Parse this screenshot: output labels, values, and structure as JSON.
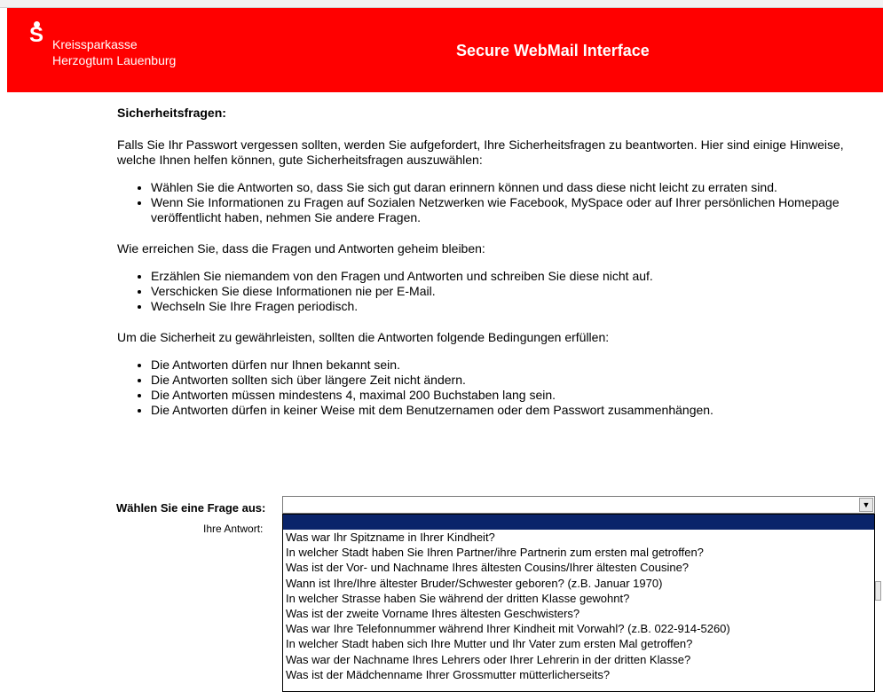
{
  "header": {
    "bank_name_line1": "Kreissparkasse",
    "bank_name_line2": "Herzogtum Lauenburg",
    "title": "Secure WebMail Interface",
    "brand_color": "#ff0000"
  },
  "content": {
    "heading": "Sicherheitsfragen:",
    "intro": "Falls Sie Ihr Passwort vergessen sollten, werden Sie aufgefordert, Ihre Sicherheitsfragen zu beantworten. Hier sind einige Hinweise, welche Ihnen helfen können, gute Sicherheitsfragen auszuwählen:",
    "tips": [
      "Wählen Sie die Antworten so, dass Sie sich gut daran erinnern können und dass diese nicht leicht zu erraten sind.",
      "Wenn Sie Informationen zu Fragen auf Sozialen Netzwerken wie Facebook, MySpace oder auf Ihrer persönlichen Homepage veröffentlicht haben, nehmen Sie andere Fragen."
    ],
    "secrecy_intro": "Wie erreichen Sie, dass die Fragen und Antworten geheim bleiben:",
    "secrecy_tips": [
      "Erzählen Sie niemandem von den Fragen und Antworten und schreiben Sie diese nicht auf.",
      "Verschicken Sie diese Informationen nie per E-Mail.",
      "Wechseln Sie Ihre Fragen periodisch."
    ],
    "conditions_intro": "Um die Sicherheit zu gewährleisten, sollten die Antworten folgende Bedingungen erfüllen:",
    "conditions": [
      "Die Antworten dürfen nur Ihnen bekannt sein.",
      "Die Antworten sollten sich über längere Zeit nicht ändern.",
      "Die Antworten müssen mindestens 4, maximal 200 Buchstaben lang sein.",
      "Die Antworten dürfen in keiner Weise mit dem Benutzernamen oder dem Passwort zusammenhängen."
    ]
  },
  "form": {
    "question_label": "Wählen Sie eine Frage aus:",
    "answer_label": "Ihre Antwort:",
    "selected_value": "",
    "options": [
      "Was war Ihr Spitzname in Ihrer Kindheit?",
      "In welcher Stadt haben Sie Ihren Partner/ihre Partnerin zum ersten mal getroffen?",
      "Was ist der Vor- und Nachname Ihres ältesten Cousins/Ihrer ältesten Cousine?",
      "Wann ist Ihre/Ihre ältester Bruder/Schwester geboren? (z.B. Januar 1970)",
      "In welcher Strasse haben Sie während der dritten Klasse gewohnt?",
      "Was ist der zweite Vorname Ihres ältesten Geschwisters?",
      "Was war Ihre Telefonnummer während Ihrer Kindheit mit Vorwahl? (z.B. 022-914-5260)",
      "In welcher Stadt haben sich Ihre Mutter und Ihr Vater zum ersten Mal getroffen?",
      "Was war der Nachname Ihres Lehrers oder Ihrer Lehrerin in der dritten Klasse?",
      "Was ist der Mädchenname Ihrer Grossmutter mütterlicherseits?"
    ],
    "highlight_color": "#0a246a"
  }
}
